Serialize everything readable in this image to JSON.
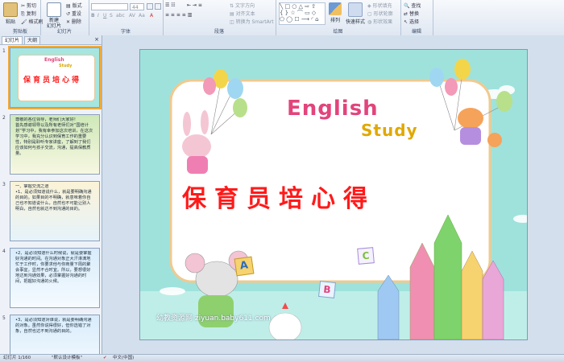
{
  "ribbon": {
    "clipboard": {
      "group_label": "剪贴板",
      "paste": "粘贴",
      "cut": "剪切",
      "copy": "复制",
      "format_painter": "格式刷"
    },
    "slides": {
      "group_label": "幻灯片",
      "new_slide": "新建\n幻灯片",
      "layout": "版式",
      "reset": "重设",
      "delete": "删除"
    },
    "font": {
      "group_label": "字体",
      "font_size": "44"
    },
    "paragraph": {
      "group_label": "段落",
      "text_direction": "文字方向",
      "align_text": "对齐文本",
      "smartart": "转换为 SmartArt"
    },
    "drawing": {
      "group_label": "绘图",
      "arrange": "排列",
      "quick_styles": "快速样式",
      "shape_fill": "形状填充",
      "shape_outline": "形状轮廓",
      "shape_effects": "形状效果"
    },
    "editing": {
      "group_label": "编辑",
      "find": "查找",
      "replace": "替换",
      "select": "选择"
    }
  },
  "panel": {
    "tab_slides": "幻灯片",
    "tab_outline": "大纲",
    "close": "×",
    "thumbs": [
      {
        "num": "1",
        "english": "English",
        "study": "Study",
        "title": "保育员培心得"
      },
      {
        "num": "2",
        "text": "尊敬的各位领导，老师们大家好！\n首先感谢领导以及所有老师们对“国培计划”学习中，我有幸参加这次培训，在这次学习中，我充分认识到保育工作的重要性，特别是聆听专家讲座，了解到了我们应该如何与孩子交流，沟通，提高保教质量。"
      },
      {
        "num": "3",
        "text": "一、掌握交流之道\n•1、是必须知道说什么，就是要明确沟通的目的。如果目的不明确，就意味着你自己也不知道说什么，自然也不可能让别人明白，自然也就达不到沟通的目的。"
      },
      {
        "num": "4",
        "text": "•2、是必须知道什么时候说，就是要掌握好沟通的时间。在沟通对象正大汗淋漓地忙于工作时，你要求他与你商量下周的聚会事宜，显然不合时宜。所以，要想很好地达到沟通效果，必须掌握好沟通的时间，把握好沟通的火候。"
      },
      {
        "num": "5",
        "text": "•3、是必须知道对谁说，就是要明确沟通的对象。虽然你说得很好，但你选错了对象，自然也达不到沟通的目的。"
      }
    ]
  },
  "slide": {
    "english": "English",
    "study": "Study",
    "title": "保育员培心得",
    "watermark": "幼教资源网 ziyuan.baby611.com",
    "block_a": "A",
    "block_b": "B",
    "block_c": "C"
  },
  "status": {
    "slide_pos": "幻灯片 1/160",
    "theme": "\"默认设计模板\"",
    "language": "中文(中国)"
  }
}
